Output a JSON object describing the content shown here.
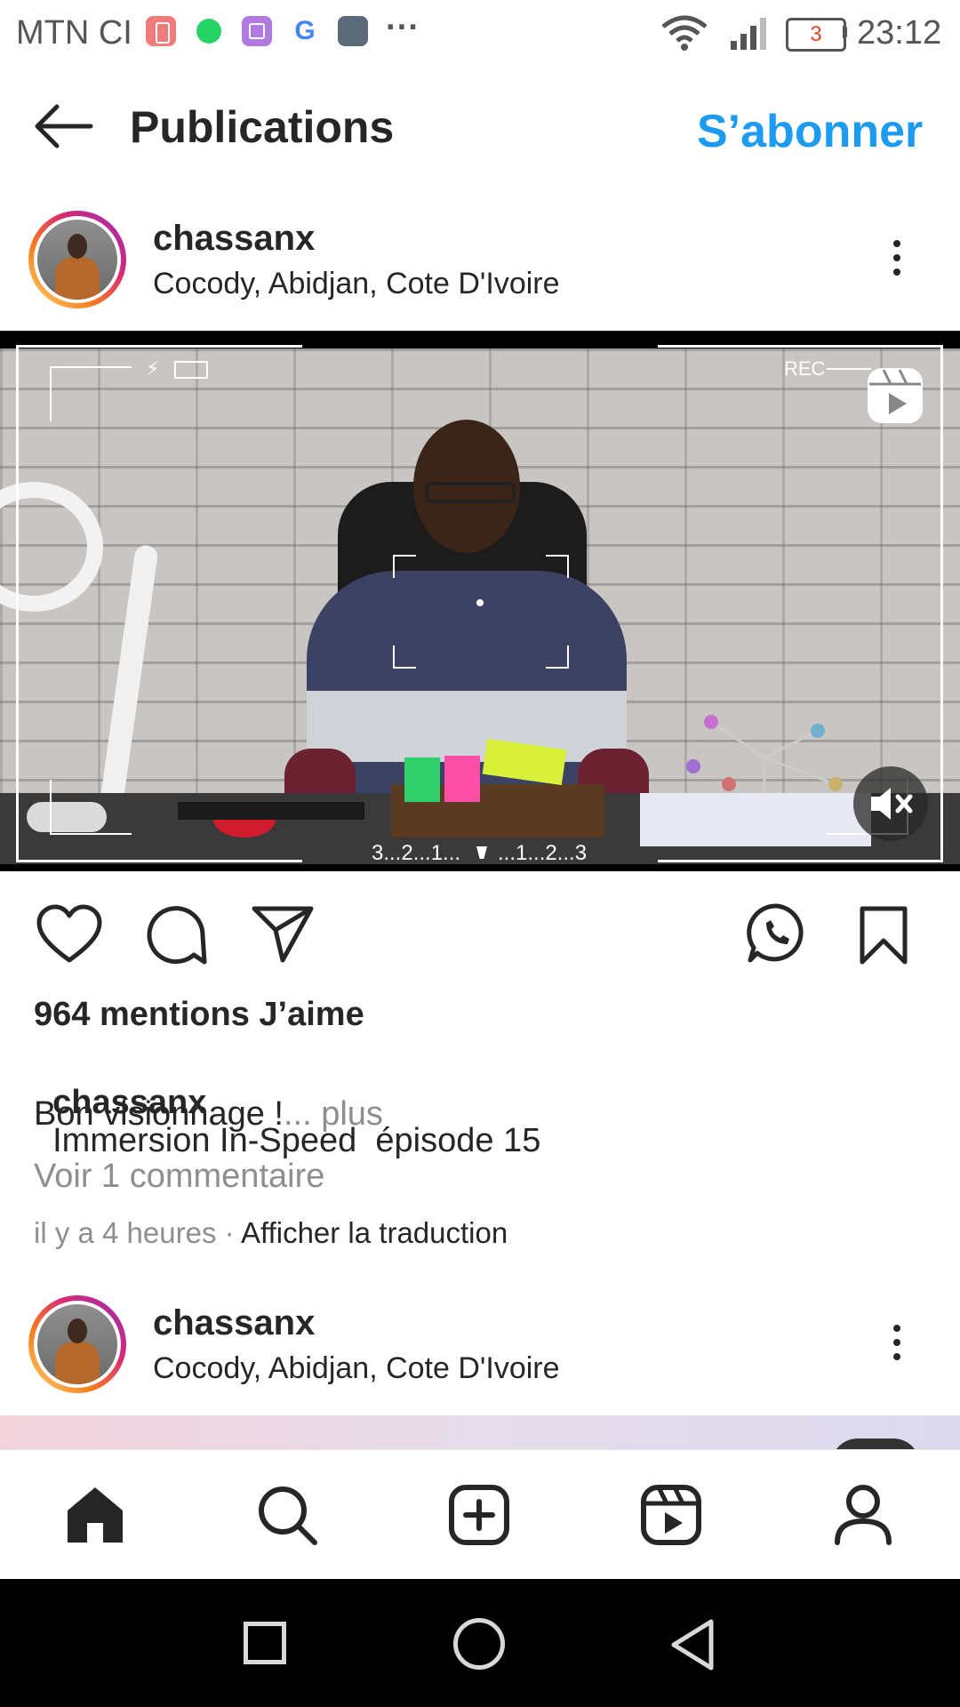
{
  "status_bar": {
    "carrier": "MTN CI",
    "more": "···",
    "battery_level": "3",
    "time": "23:12",
    "app_icons": [
      "battery-saver-icon",
      "whatsapp-icon",
      "gallery-icon",
      "google-icon",
      "call-of-duty-icon"
    ]
  },
  "header": {
    "title": "Publications",
    "follow_label": "S’abonner"
  },
  "posts": [
    {
      "username": "chassanx",
      "location": "Cocody, Abidjan, Cote D'Ivoire"
    },
    {
      "username": "chassanx",
      "location": "Cocody, Abidjan, Cote D'Ivoire"
    }
  ],
  "video": {
    "rec_label": "REC",
    "countdown": "3...2...1...",
    "countup": "...1...2...3"
  },
  "post": {
    "likes": "964 mentions J’aime",
    "caption_user": "chassanx",
    "caption_text": "Immersion In-Speed  épisode 15",
    "caption_line2": "Bon visionnage !",
    "more": "... plus",
    "view_comments": "Voir 1 commentaire",
    "time_ago": "il y a 4 heures",
    "separator": "·",
    "translate": "Afficher la traduction"
  },
  "colors": {
    "accent": "#1c9bf0",
    "text": "#262626",
    "muted": "#8e8e8e"
  }
}
